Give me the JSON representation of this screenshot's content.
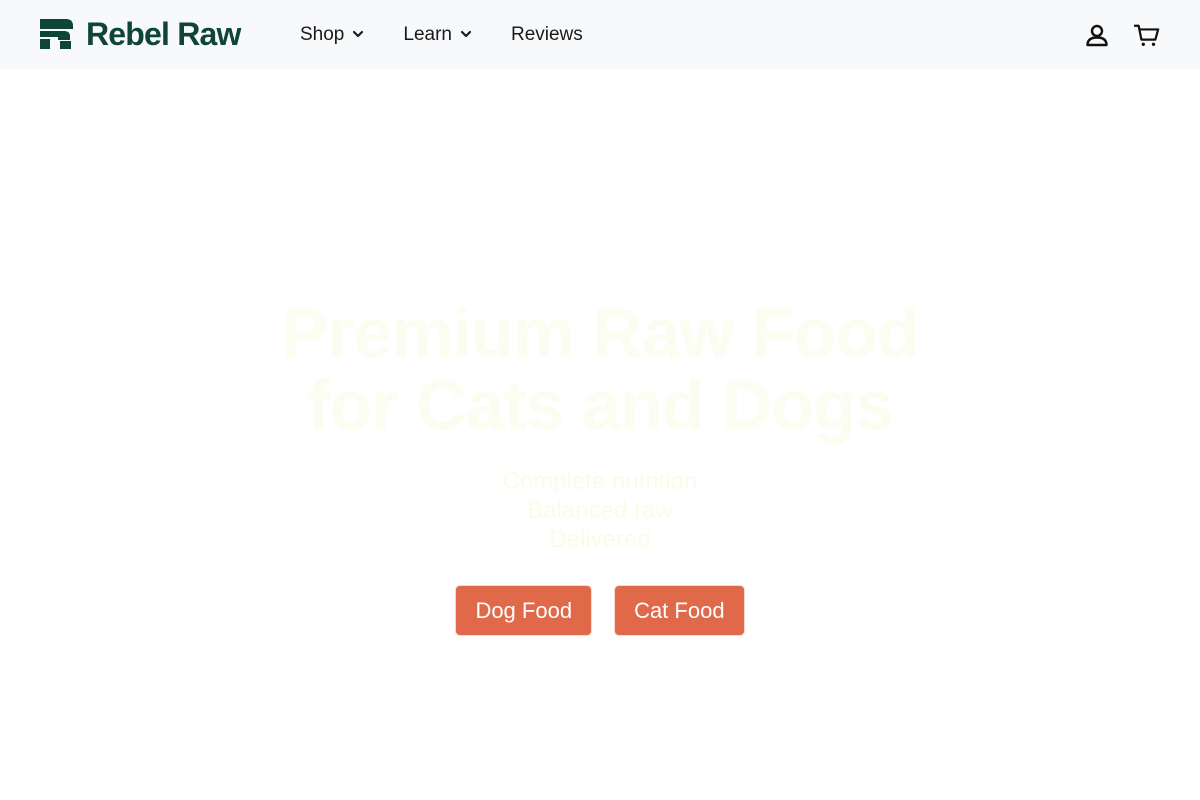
{
  "brand": {
    "name": "Rebel Raw",
    "color": "#0e4535"
  },
  "nav": {
    "items": [
      {
        "label": "Shop",
        "has_dropdown": true
      },
      {
        "label": "Learn",
        "has_dropdown": true
      },
      {
        "label": "Reviews",
        "has_dropdown": false
      }
    ]
  },
  "header_icons": {
    "account": "account-icon",
    "cart": "cart-icon"
  },
  "hero": {
    "title_line1": "Premium Raw Food",
    "title_line2": "for Cats and Dogs",
    "subtitle_line1": "Complete nutrition",
    "subtitle_line2": "Balanced raw",
    "subtitle_line3": "Delivered",
    "buttons": [
      {
        "label": "Dog Food"
      },
      {
        "label": "Cat Food"
      }
    ],
    "accent_color": "#e0694a"
  }
}
